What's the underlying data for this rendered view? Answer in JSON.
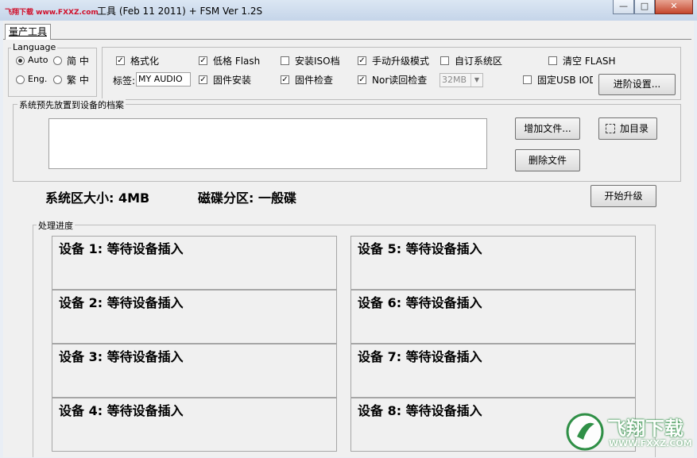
{
  "window": {
    "title": "工具 (Feb 11 2011) + FSM Ver 1.2S",
    "watermark": "飞翔下载 www.FXXZ.com",
    "controls": [
      "—",
      "□",
      "✕"
    ]
  },
  "tab": {
    "label": "量产工具"
  },
  "language": {
    "legend": "Language",
    "auto": "Auto",
    "simplified": "简 中",
    "eng": "Eng.",
    "traditional": "繁 中",
    "selected": "Auto"
  },
  "options": {
    "format": {
      "label": "格式化",
      "checked": true
    },
    "low_format": {
      "label": "低格 Flash",
      "checked": true
    },
    "install_iso": {
      "label": "安装ISO档",
      "checked": false
    },
    "manual_upgrade": {
      "label": "手动升级模式",
      "checked": true
    },
    "custom_system": {
      "label": "自订系统区",
      "checked": false
    },
    "clear_flash": {
      "label": "清空 FLASH",
      "checked": false
    },
    "volume_label": "标签:",
    "volume_value": "MY AUDIO",
    "firmware_install": {
      "label": "固件安装",
      "checked": true
    },
    "firmware_check": {
      "label": "固件检查",
      "checked": true
    },
    "nor_check": {
      "label": "Nor读回检查",
      "checked": true
    },
    "nor_size": "32MB",
    "fixed_usb": {
      "label": "固定USB IOD",
      "checked": false
    },
    "advanced_button": "进阶设置..."
  },
  "preload": {
    "legend": "系统预先放置到设备的档案",
    "add_file_button": "增加文件...",
    "add_dir_button": "加目录",
    "delete_file_button": "删除文件"
  },
  "status": {
    "system_size": "系统区大小: 4MB",
    "disk_partition": "磁碟分区: 一般碟",
    "start_button": "开始升级"
  },
  "progress": {
    "legend": "处理进度",
    "devices": [
      "设备 1: 等待设备插入",
      "设备 2: 等待设备插入",
      "设备 3: 等待设备插入",
      "设备 4: 等待设备插入",
      "设备 5: 等待设备插入",
      "设备 6: 等待设备插入",
      "设备 7: 等待设备插入",
      "设备 8: 等待设备插入"
    ]
  },
  "logo": {
    "text": "飞翔下载",
    "url": "WWW.FXXZ.COM"
  },
  "colors": {
    "titlebar": "#c5d5e9",
    "close": "#c5462c",
    "logo_green": "#2f8f46"
  }
}
